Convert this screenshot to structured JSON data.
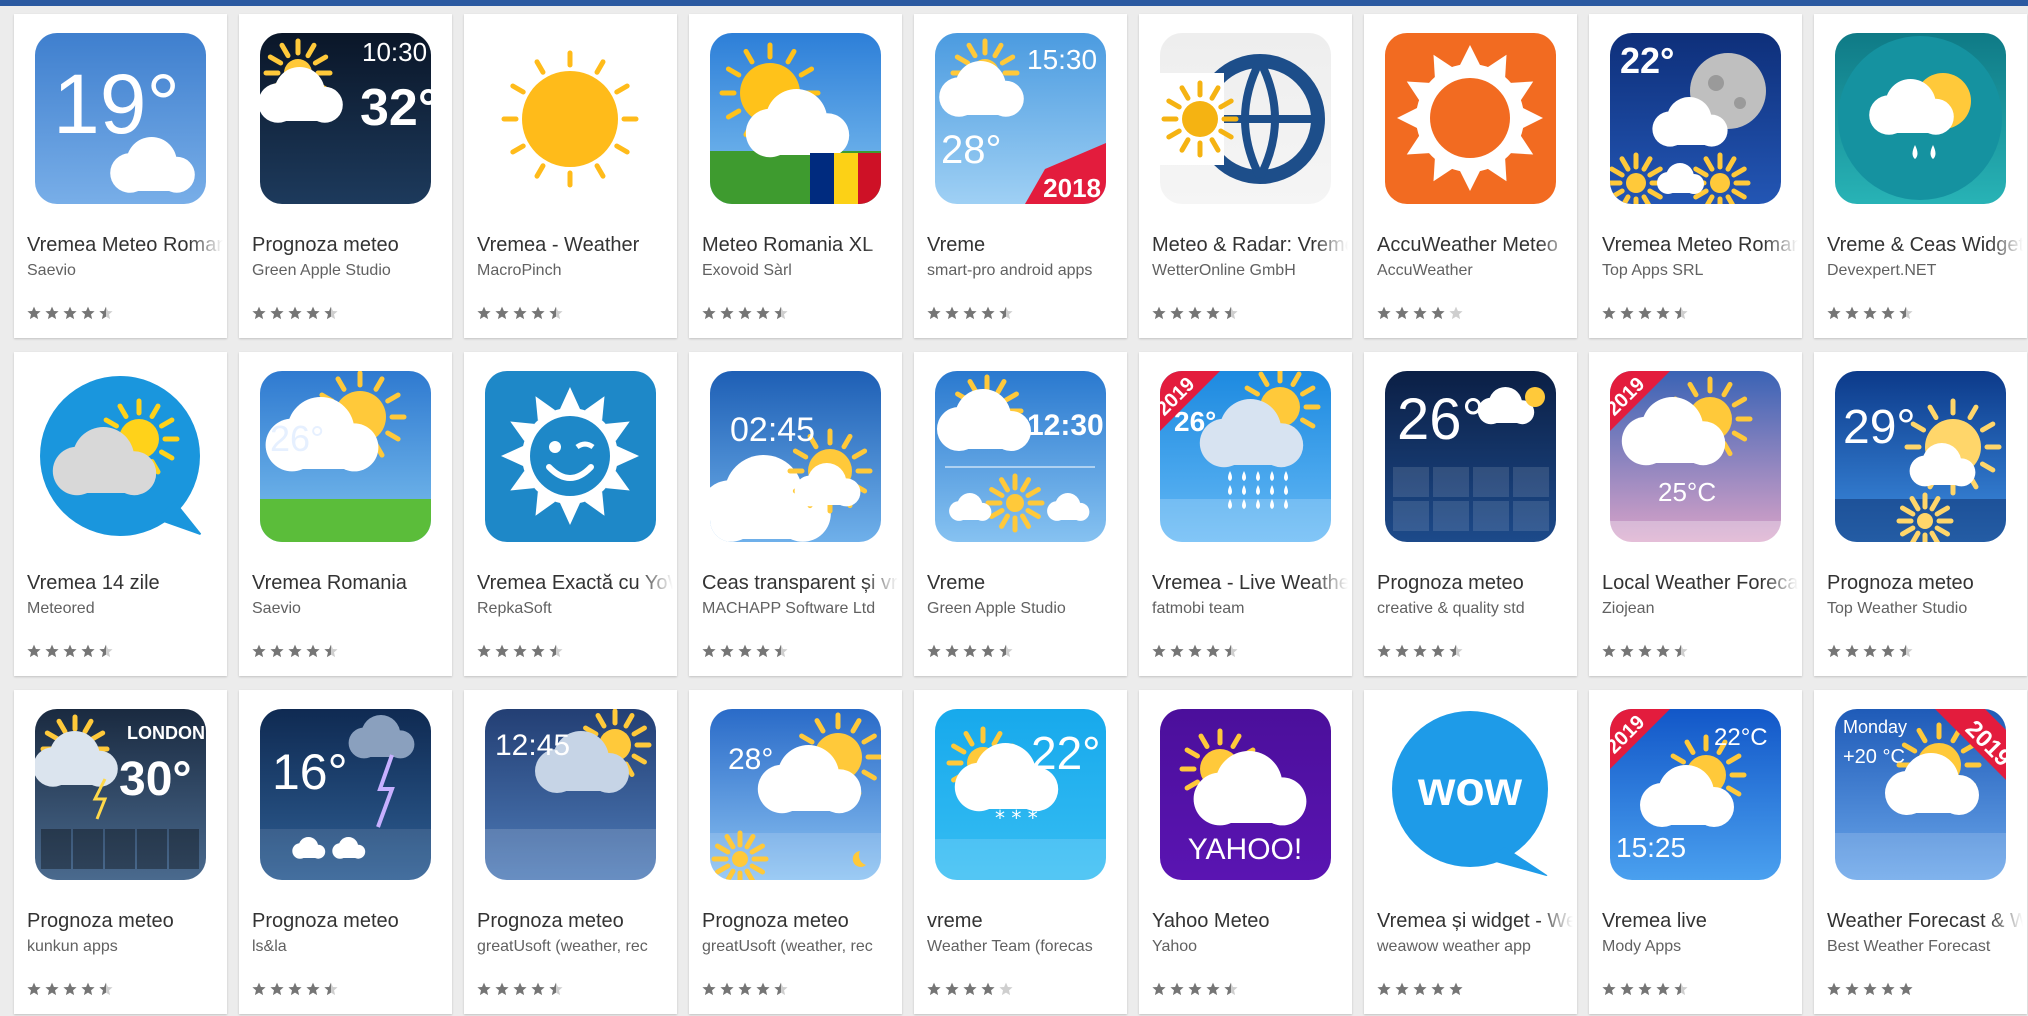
{
  "colors": {
    "star": "#757575",
    "star_empty": "#cfcfcf",
    "accent": "#2b5aa1"
  },
  "apps": [
    {
      "title": "Vremea Meteo Romania",
      "developer": "Saevio",
      "rating": 4.5,
      "icon": "weather-19-degrees-clouds-icon",
      "art": "temp",
      "bg": [
        "#3f7fce",
        "#78aee8"
      ],
      "text": "19°",
      "text_color": "#ffffff",
      "accent": "#ffffff"
    },
    {
      "title": "Prognoza meteo",
      "developer": "Green Apple Studio",
      "rating": 4.5,
      "icon": "weather-clock-10-30-rain-icon",
      "art": "clock",
      "bg": [
        "#0a1628",
        "#1d3a5c"
      ],
      "text": "10:30",
      "text2": "32°",
      "text_color": "#ffffff",
      "accent": "#ffc93a"
    },
    {
      "title": "Vremea - Weather",
      "developer": "MacroPinch",
      "rating": 4.5,
      "icon": "sun-icon",
      "art": "sun",
      "bg": [
        "#ffffff",
        "#ffffff"
      ],
      "accent": "#ffbb1a"
    },
    {
      "title": "Meteo Romania XL",
      "developer": "Exovoid Sàrl",
      "rating": 4.5,
      "icon": "sun-cloud-romanian-flag-icon",
      "art": "flag",
      "bg": [
        "#2d7fd8",
        "#7fc0f0"
      ],
      "accent": "#ffc21a"
    },
    {
      "title": "Vreme",
      "developer": "smart-pro android apps",
      "rating": 4.5,
      "icon": "weather-2018-clock-icon",
      "art": "clockbadge",
      "bg": [
        "#4b9be0",
        "#9fd0f4"
      ],
      "text": "15:30",
      "text2": "28°",
      "badge": "2018",
      "text_color": "#ffffff",
      "accent": "#ffc93a"
    },
    {
      "title": "Meteo & Radar: Vremea",
      "developer": "WetterOnline GmbH",
      "rating": 4.5,
      "icon": "sun-globe-radar-icon",
      "art": "globe",
      "bg": [
        "#eeeeee",
        "#f5f5f5"
      ],
      "accent": "#1d4e8a"
    },
    {
      "title": "AccuWeather Meteo",
      "developer": "AccuWeather",
      "rating": 4,
      "icon": "accuweather-sun-icon",
      "art": "accu",
      "bg": [
        "#f26b21",
        "#f26b21"
      ],
      "accent": "#ffffff"
    },
    {
      "title": "Vremea Meteo Romania",
      "developer": "Top Apps SRL",
      "rating": 4.5,
      "icon": "moon-clouds-22-degrees-icon",
      "art": "moon",
      "bg": [
        "#0e2f7a",
        "#2356b4"
      ],
      "text": "22°",
      "text_color": "#ffffff",
      "accent": "#ffc93a"
    },
    {
      "title": "Vreme & Ceas Widget",
      "developer": "Devexpert.NET",
      "rating": 4.5,
      "icon": "cloud-sun-rain-drops-icon",
      "art": "cloudrain",
      "bg": [
        "#0f7a86",
        "#28b3b6"
      ],
      "accent": "#ffc93a"
    },
    {
      "title": "Vremea 14 zile",
      "developer": "Meteored",
      "rating": 4.5,
      "icon": "speech-bubble-sun-cloud-icon",
      "art": "bubble",
      "bg": [
        "#ffffff",
        "#ffffff"
      ],
      "accent": "#1a96dd"
    },
    {
      "title": "Vremea Romania",
      "developer": "Saevio",
      "rating": 4.5,
      "icon": "sun-cloud-26-degrees-icon",
      "art": "field",
      "bg": [
        "#2f7ad0",
        "#7cc0ef"
      ],
      "text": "26°",
      "text_color": "#ffffff",
      "accent": "#ffc93a"
    },
    {
      "title": "Vremea Exactă cu YoWindow",
      "developer": "RepkaSoft",
      "rating": 4.5,
      "icon": "smiling-sun-icon",
      "art": "smile",
      "bg": [
        "#1e88c8",
        "#1e88c8"
      ],
      "accent": "#ffffff"
    },
    {
      "title": "Ceas transparent și vremea",
      "developer": "MACHAPP Software Ltd",
      "rating": 4.5,
      "icon": "transparent-clock-sun-cloud-icon",
      "art": "clock2",
      "bg": [
        "#1e5fb5",
        "#6fb0ea"
      ],
      "text": "02:45",
      "text_color": "#ffffff",
      "accent": "#ffc93a"
    },
    {
      "title": "Vreme",
      "developer": "Green Apple Studio",
      "rating": 4.5,
      "icon": "clock-12-30-sun-cloud-icon",
      "art": "clock3",
      "bg": [
        "#2a79cf",
        "#86c2f1"
      ],
      "text": "12:30",
      "text_color": "#ffffff",
      "accent": "#ffc93a"
    },
    {
      "title": "Vremea - Live Weather",
      "developer": "fatmobi team",
      "rating": 4.5,
      "icon": "rain-cloud-2019-icon",
      "art": "rain2019",
      "bg": [
        "#1d8ae0",
        "#63b8f5"
      ],
      "text": "26°",
      "badge": "2019",
      "text_color": "#ffffff",
      "accent": "#ffc93a"
    },
    {
      "title": "Prognoza meteo",
      "developer": "creative & quality std",
      "rating": 4.5,
      "icon": "moon-26-degrees-grid-icon",
      "art": "moongrid",
      "bg": [
        "#0b1f45",
        "#1d4a8a"
      ],
      "text": "26°",
      "text_color": "#ffffff",
      "accent": "#ffc93a"
    },
    {
      "title": "Local Weather Forecast",
      "developer": "Ziojean",
      "rating": 4.5,
      "icon": "sunset-25-degrees-2019-icon",
      "art": "sunset",
      "bg": [
        "#3a63b5",
        "#d9a3c8"
      ],
      "text": "25°C",
      "badge": "2019",
      "text_color": "#ffffff",
      "accent": "#ffc93a"
    },
    {
      "title": "Prognoza meteo",
      "developer": "Top Weather Studio",
      "rating": 4.5,
      "icon": "sun-29-degrees-forecast-icon",
      "art": "sun29",
      "bg": [
        "#0c3a8a",
        "#3e8fe3"
      ],
      "text": "29°",
      "text_color": "#ffffff",
      "accent": "#ffd66a"
    },
    {
      "title": "Prognoza meteo",
      "developer": "kunkun apps",
      "rating": 4.5,
      "icon": "london-30-degrees-storm-icon",
      "art": "london",
      "bg": [
        "#1a2a40",
        "#4a6a8e"
      ],
      "text": "30°",
      "text2": "LONDON",
      "text_color": "#ffffff",
      "accent": "#ffc93a"
    },
    {
      "title": "Prognoza meteo",
      "developer": "ls&la",
      "rating": 4.5,
      "icon": "lightning-16-degrees-icon",
      "art": "lightning",
      "bg": [
        "#0f2a52",
        "#2f5f94"
      ],
      "text": "16°",
      "text_color": "#ffffff",
      "accent": "#c7b0ff"
    },
    {
      "title": "Prognoza meteo",
      "developer": "greatUsoft (weather, rec",
      "rating": 4.5,
      "icon": "clock-12-45-rain-icon",
      "art": "rain1245",
      "bg": [
        "#233f74",
        "#4e7bb8"
      ],
      "text": "12:45",
      "text_color": "#ffffff",
      "accent": "#ffc93a"
    },
    {
      "title": "Prognoza meteo",
      "developer": "greatUsoft (weather, rec",
      "rating": 4.5,
      "icon": "san-francisco-28-degrees-icon",
      "art": "sf",
      "bg": [
        "#2a6bc8",
        "#8bc2f2"
      ],
      "text": "28°",
      "text_color": "#ffffff",
      "accent": "#ffc93a"
    },
    {
      "title": "vreme",
      "developer": "Weather Team (forecas",
      "rating": 4,
      "icon": "sun-cloud-snow-22-degrees-icon",
      "art": "cyan",
      "bg": [
        "#17a9ec",
        "#36bdf3"
      ],
      "text": "22°",
      "text_color": "#ffffff",
      "accent": "#ffc93a"
    },
    {
      "title": "Yahoo Meteo",
      "developer": "Yahoo",
      "rating": 4.5,
      "icon": "yahoo-sun-cloud-icon",
      "art": "yahoo",
      "bg": [
        "#4b0f9b",
        "#5a14b2"
      ],
      "text": "YAHOO!",
      "text_color": "#ffffff",
      "accent": "#ffc93a"
    },
    {
      "title": "Vremea și widget - Weawow",
      "developer": "weawow weather app",
      "rating": 5,
      "icon": "wow-speech-bubble-icon",
      "art": "wow",
      "bg": [
        "#ffffff",
        "#ffffff"
      ],
      "text": "wow",
      "text_color": "#ffffff",
      "accent": "#1e9be8"
    },
    {
      "title": "Vremea live",
      "developer": "Mody Apps",
      "rating": 4.5,
      "icon": "sun-cloud-2019-clock-icon",
      "art": "live2019",
      "bg": [
        "#1257c8",
        "#4aa0ef"
      ],
      "text": "15:25",
      "text2": "22°C",
      "badge": "2019",
      "text_color": "#ffffff",
      "accent": "#ffc93a"
    },
    {
      "title": "Weather Forecast & Widget",
      "developer": "Best Weather Forecast",
      "rating": 5,
      "icon": "monday-20-degrees-2019-icon",
      "art": "monday",
      "bg": [
        "#1f5bb8",
        "#6aa6ea"
      ],
      "text": "Monday",
      "text2": "+20 °C",
      "badge": "2019",
      "text_color": "#ffffff",
      "accent": "#ffc93a"
    }
  ]
}
